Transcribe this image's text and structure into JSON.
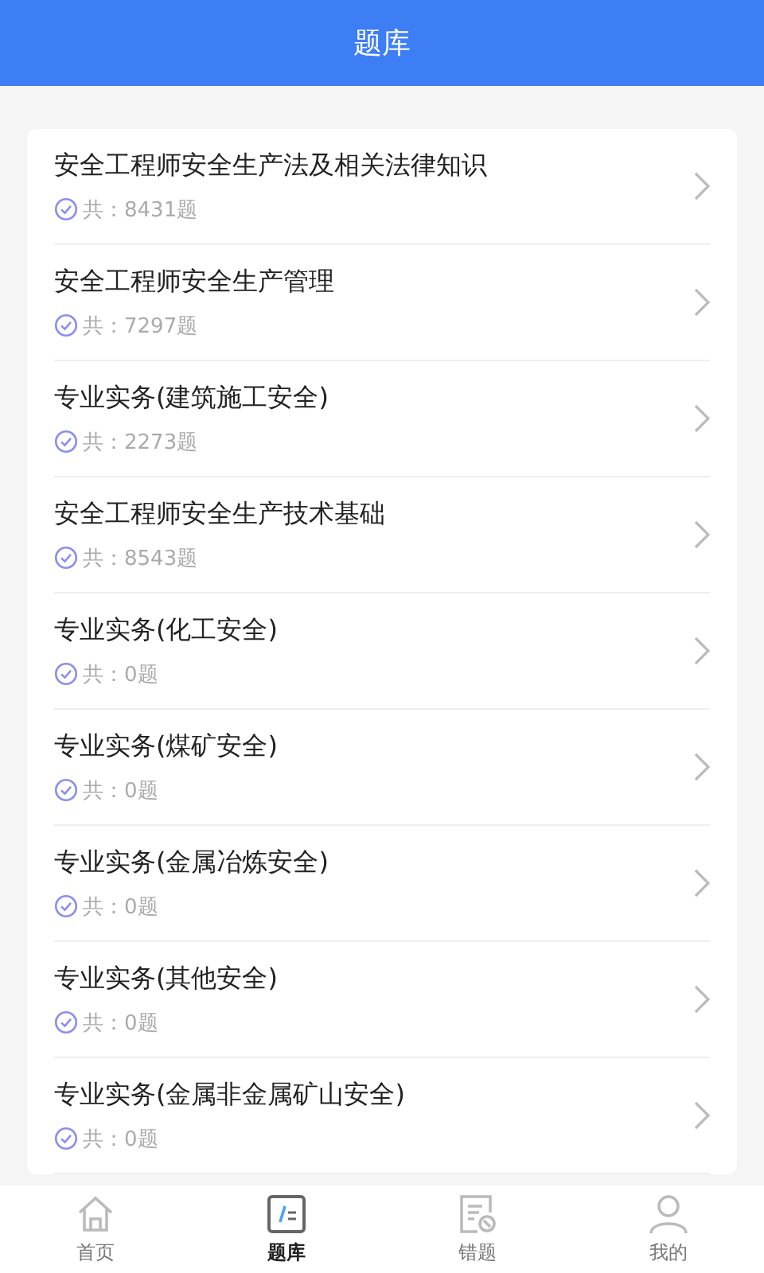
{
  "header": {
    "title": "题库"
  },
  "items": [
    {
      "title": "安全工程师安全生产法及相关法律知识",
      "count": "共：8431题"
    },
    {
      "title": "安全工程师安全生产管理",
      "count": "共：7297题"
    },
    {
      "title": "专业实务(建筑施工安全)",
      "count": "共：2273题"
    },
    {
      "title": "安全工程师安全生产技术基础",
      "count": "共：8543题"
    },
    {
      "title": "专业实务(化工安全)",
      "count": "共：0题"
    },
    {
      "title": "专业实务(煤矿安全)",
      "count": "共：0题"
    },
    {
      "title": "专业实务(金属冶炼安全)",
      "count": "共：0题"
    },
    {
      "title": "专业实务(其他安全)",
      "count": "共：0题"
    },
    {
      "title": "专业实务(金属非金属矿山安全)",
      "count": "共：0题"
    }
  ],
  "tabs": [
    {
      "label": "首页",
      "kind": "home",
      "selected": false
    },
    {
      "label": "题库",
      "kind": "bank",
      "selected": true
    },
    {
      "label": "错题",
      "kind": "wrong",
      "selected": false
    },
    {
      "label": "我的",
      "kind": "me",
      "selected": false
    }
  ]
}
